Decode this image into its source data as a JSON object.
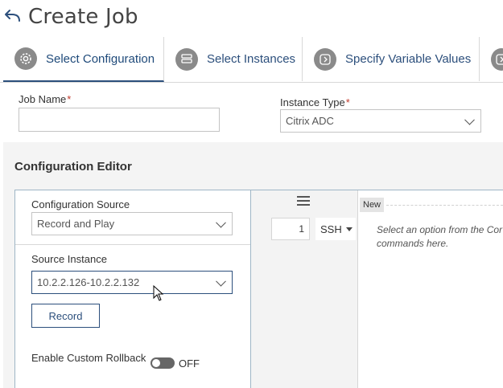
{
  "header": {
    "title": "Create Job"
  },
  "tabs": [
    {
      "label": "Select Configuration",
      "active": true,
      "icon": "gear-icon"
    },
    {
      "label": "Select Instances",
      "active": false,
      "icon": "instances-icon"
    },
    {
      "label": "Specify Variable Values",
      "active": false,
      "icon": "variables-icon"
    }
  ],
  "form": {
    "job_name": {
      "label": "Job Name",
      "required": "*",
      "value": ""
    },
    "instance_type": {
      "label": "Instance Type",
      "required": "*",
      "value": "Citrix ADC"
    }
  },
  "editor": {
    "title": "Configuration Editor",
    "config_source": {
      "label": "Configuration Source",
      "value": "Record and Play"
    },
    "source_instance": {
      "label": "Source Instance",
      "value": "10.2.2.126-10.2.2.132"
    },
    "record_label": "Record",
    "rollback": {
      "label": "Enable Custom Rollback",
      "state": "OFF"
    },
    "line_number": "1",
    "mode": "SSH",
    "new_tag": "New",
    "hint": "Select an option from the Cor\ncommands here."
  },
  "colors": {
    "accent": "#2c4f7c",
    "required": "#c0392b",
    "icon_gray": "#8a8a8a"
  }
}
